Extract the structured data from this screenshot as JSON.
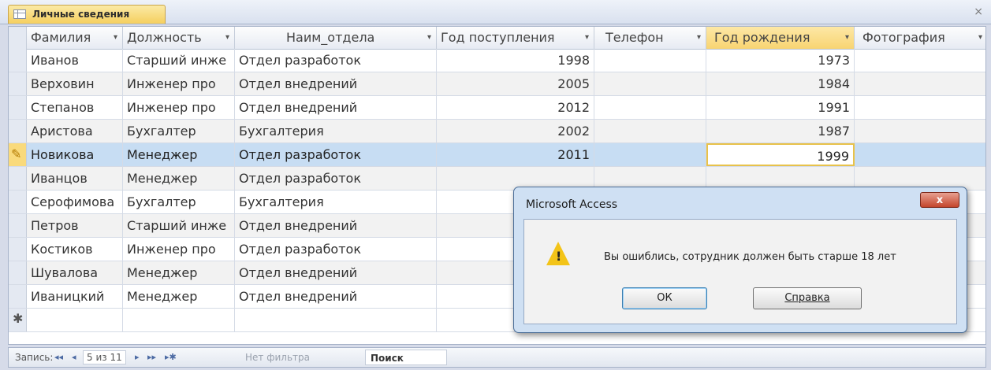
{
  "tab": {
    "title": "Личные сведения",
    "close": "×"
  },
  "columns": [
    {
      "label": "Фамилия"
    },
    {
      "label": "Должность"
    },
    {
      "label": "Наим_отдела"
    },
    {
      "label": "Год поступления"
    },
    {
      "label": "Телефон"
    },
    {
      "label": "Год рождения"
    },
    {
      "label": "Фотография"
    }
  ],
  "rows": [
    [
      "Иванов",
      "Старший инже",
      "Отдел разработок",
      "1998",
      "",
      "1973",
      ""
    ],
    [
      "Верховин",
      "Инженер про",
      "Отдел внедрений",
      "2005",
      "",
      "1984",
      ""
    ],
    [
      "Степанов",
      "Инженер про",
      "Отдел внедрений",
      "2012",
      "",
      "1991",
      ""
    ],
    [
      "Аристова",
      "Бухгалтер",
      "Бухгалтерия",
      "2002",
      "",
      "1987",
      ""
    ],
    [
      "Новикова",
      "Менеджер",
      "Отдел разработок",
      "2011",
      "",
      "1999",
      ""
    ],
    [
      "Иванцов",
      "Менеджер",
      "Отдел разработок",
      "",
      "",
      "",
      ""
    ],
    [
      "Серофимова",
      "Бухгалтер",
      "Бухгалтерия",
      "",
      "",
      "",
      ""
    ],
    [
      "Петров",
      "Старший инже",
      "Отдел внедрений",
      "",
      "",
      "",
      ""
    ],
    [
      "Костиков",
      "Инженер про",
      "Отдел разработок",
      "",
      "",
      "",
      ""
    ],
    [
      "Шувалова",
      "Менеджер",
      "Отдел внедрений",
      "",
      "",
      "",
      ""
    ],
    [
      "Иваницкий",
      "Менеджер",
      "Отдел внедрений",
      "",
      "",
      "",
      ""
    ]
  ],
  "new_row_marker": "✱",
  "edit_marker": "✎",
  "navbar": {
    "records_label": "Запись:",
    "first": "◂◂",
    "prev": "◂",
    "record_pos": "5 из 11",
    "next": "▸",
    "last": "▸▸",
    "new": "▸✱",
    "filter": "Нет фильтра",
    "search": "Поиск"
  },
  "dialog": {
    "title": "Microsoft Access",
    "close": "x",
    "message": "Вы ошиблись, сотрудник должен быть старше 18 лет",
    "ok": "ОК",
    "help": "Справка",
    "icon": "warning-icon",
    "icon_mark": "!"
  }
}
